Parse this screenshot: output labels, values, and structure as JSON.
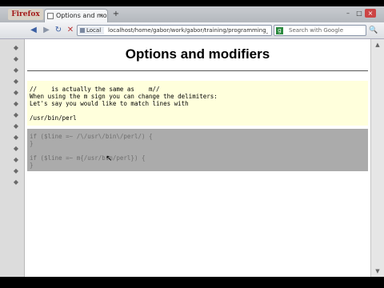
{
  "browser": {
    "app_logo": "Firefox",
    "tab_title": "Options and mod...",
    "tab_close": "×",
    "new_tab": "+",
    "window_min": "–",
    "window_max": "□",
    "window_close": "×",
    "nav": {
      "back": "◀",
      "forward": "▶",
      "reload": "↻",
      "stop": "✕"
    },
    "url_site_label": "Local",
    "url": "localhost/home/gabor/work/gabor/training/programming_per",
    "search_placeholder": "Search with Google",
    "search_engine_icon": "g",
    "search_go": "🔍"
  },
  "sidebar": {
    "icons": [
      "◆",
      "◆",
      "◆",
      "◆",
      "◆",
      "◆",
      "◆",
      "◆",
      "◆",
      "◆",
      "◆",
      "◆",
      "◆"
    ]
  },
  "page": {
    "title": "Options and modifiers",
    "code_lines": [
      "//    is actually the same as    m//",
      "When using the m sign you can change the delimiters:",
      "Let's say you would like to match lines with",
      "",
      "/usr/bin/perl"
    ],
    "gray_lines": [
      "if ($line =~ /\\/usr\\/bin\\/perl/) {",
      "}",
      "",
      "if ($line =~ m{/usr/bin/perl}) {",
      "}"
    ]
  },
  "colors": {
    "code_background": "#ffffdc",
    "highlight_background": "#ababab"
  }
}
